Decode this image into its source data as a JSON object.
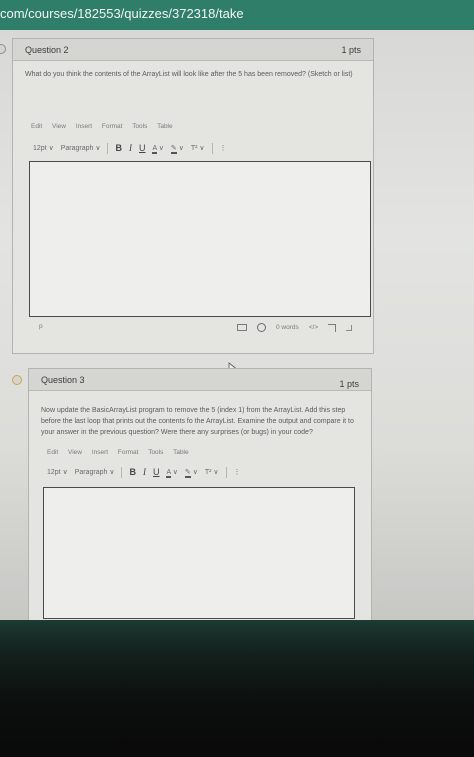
{
  "browser": {
    "url_fragment": "com/courses/182553/quizzes/372318/take"
  },
  "question2": {
    "title": "Question 2",
    "points": "1 pts",
    "text": "What do you think the contents of the ArrayList will look like after the 5 has been removed? (Sketch or list)",
    "menu": [
      "Edit",
      "View",
      "Insert",
      "Format",
      "Tools",
      "Table"
    ],
    "font_size": "12pt",
    "block_format": "Paragraph",
    "status_path": "p",
    "word_count": "0 words",
    "code_view": "</>"
  },
  "question3": {
    "title": "Question 3",
    "points": "1 pts",
    "text": "Now update the BasicArrayList program to remove the 5 (index 1) from the ArrayList. Add this step before the last loop that prints out the contents fo the ArrayList. Examine the output and compare it to your answer in the previous question? Were there any surprises (or bugs) in your code?",
    "menu": [
      "Edit",
      "View",
      "Insert",
      "Format",
      "Tools",
      "Table"
    ],
    "font_size": "12pt",
    "block_format": "Paragraph"
  },
  "toolbar_glyphs": {
    "bold": "B",
    "italic": "I",
    "underline": "U",
    "text_color": "A",
    "highlight": "✎",
    "superscript": "T²",
    "more": "⋮",
    "chevron": "∨"
  },
  "colors": {
    "url_bar": "#2f7e6a",
    "page_bg": "#e0e0dd",
    "editor_border": "#4a4a4a"
  }
}
